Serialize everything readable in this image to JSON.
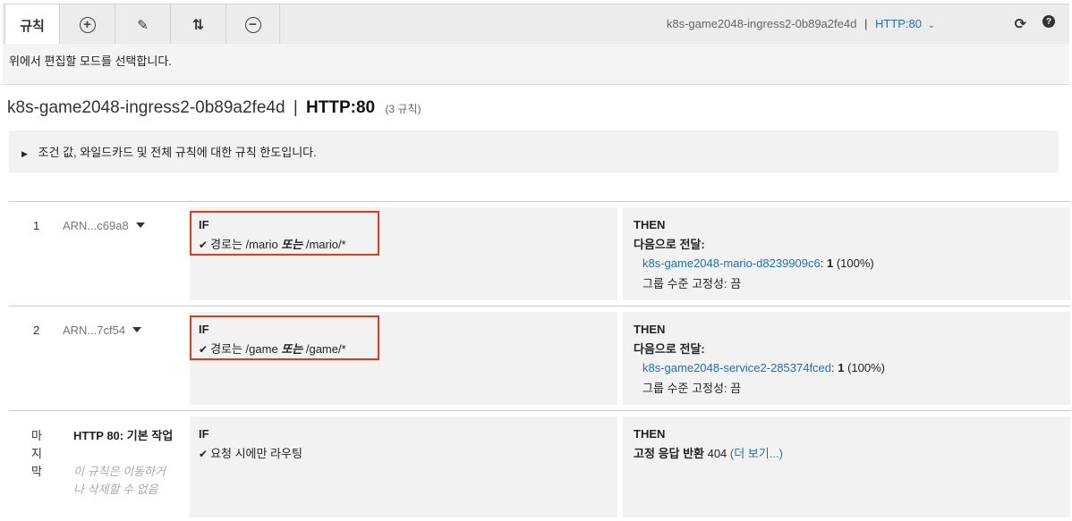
{
  "toolbar": {
    "rules_tab": "규칙",
    "icons": {
      "add": "plus-circle-icon",
      "edit": "pencil-icon",
      "reorder": "sort-arrows-icon",
      "delete": "minus-circle-icon",
      "refresh": "refresh-icon",
      "help": "help-icon"
    },
    "lb_name": "k8s-game2048-ingress2-0b89a2fe4d",
    "separator": "|",
    "listener": "HTTP:80"
  },
  "hint": "위에서 편집할 모드를 선택합니다.",
  "title": {
    "lb_name": "k8s-game2048-ingress2-0b89a2fe4d",
    "separator": "|",
    "listener": "HTTP:80",
    "count": "(3 규칙)"
  },
  "limits": {
    "text": "조건 값, 와일드카드 및 전체 규칙에 대한 규칙 한도입니다."
  },
  "rules": [
    {
      "priority": "1",
      "arn": "ARN...c69a8",
      "if_label": "IF",
      "condition": {
        "prefix": "경로는 /mario ",
        "or": "또는",
        "suffix": " /mario/*"
      },
      "then_label": "THEN",
      "action_label": "다음으로 전달:",
      "target_group": "k8s-game2048-mario-d8239909c6",
      "weight": "1",
      "percent": " (100%)",
      "stickiness": "그룹 수준 고정성: 끔"
    },
    {
      "priority": "2",
      "arn": "ARN...7cf54",
      "if_label": "IF",
      "condition": {
        "prefix": "경로는 /game ",
        "or": "또는",
        "suffix": " /game/*"
      },
      "then_label": "THEN",
      "action_label": "다음으로 전달:",
      "target_group": "k8s-game2048-service2-285374fced",
      "weight": "1",
      "percent": " (100%)",
      "stickiness": "그룹 수준 고정성: 끔"
    }
  ],
  "default_rule": {
    "priority_label": "마지막",
    "title": "HTTP 80: 기본 작업",
    "note": "이 규칙은 이동하거나 삭제할 수 없음",
    "if_label": "IF",
    "condition": "요청 시에만 라우팅",
    "then_label": "THEN",
    "action_label": "고정 응답 반환",
    "status": " 404 ",
    "more": "(더 보기...)"
  },
  "colors": {
    "link": "#1f6fb5",
    "highlight": "#e03b1f",
    "panel": "#f2f2f2"
  }
}
